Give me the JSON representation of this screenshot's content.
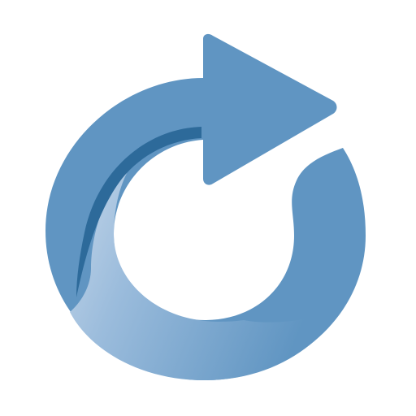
{
  "icon": {
    "name": "redo-arrow-icon",
    "colors": {
      "primary": "#6095C2",
      "shadow": "#2D6A9A",
      "highlight": "#C6D7E9",
      "background": "#FFFFFF"
    }
  }
}
